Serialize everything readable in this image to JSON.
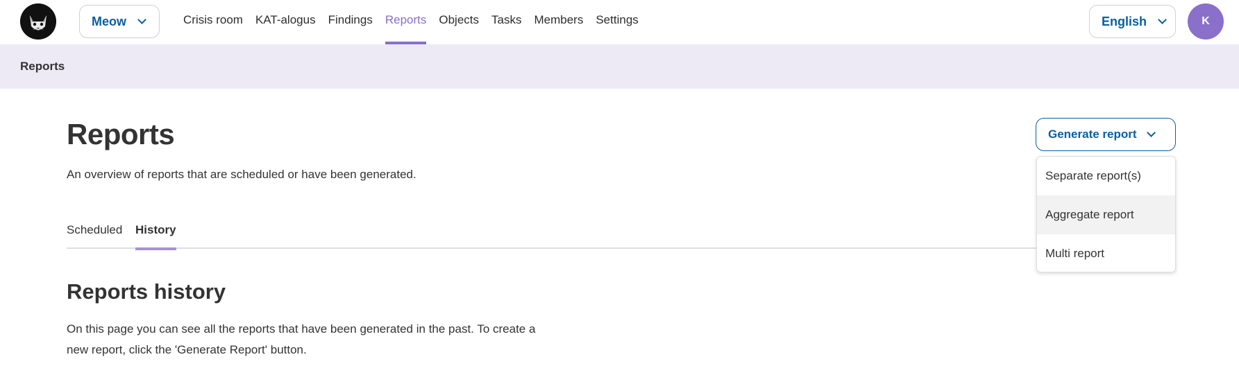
{
  "header": {
    "organization": "Meow",
    "nav": [
      "Crisis room",
      "KAT-alogus",
      "Findings",
      "Reports",
      "Objects",
      "Tasks",
      "Members",
      "Settings"
    ],
    "active_nav": "Reports",
    "language": "English",
    "avatar_initial": "K"
  },
  "breadcrumb": {
    "current": "Reports"
  },
  "main": {
    "title": "Reports",
    "subtitle": "An overview of reports that are scheduled or have been generated.",
    "tabs": [
      {
        "label": "Scheduled"
      },
      {
        "label": "History"
      }
    ],
    "active_tab": "History",
    "section_title": "Reports history",
    "section_text": "On this page you can see all the reports that have been generated in the past. To create a new report, click the 'Generate Report' button."
  },
  "generate": {
    "button_label": "Generate report",
    "options": [
      "Separate report(s)",
      "Aggregate report",
      "Multi report"
    ],
    "hovered_option": "Aggregate report"
  },
  "colors": {
    "accent": "#8a6fcb",
    "link": "#0a5e9e",
    "breadcrumb_bg": "#edeaf6"
  }
}
